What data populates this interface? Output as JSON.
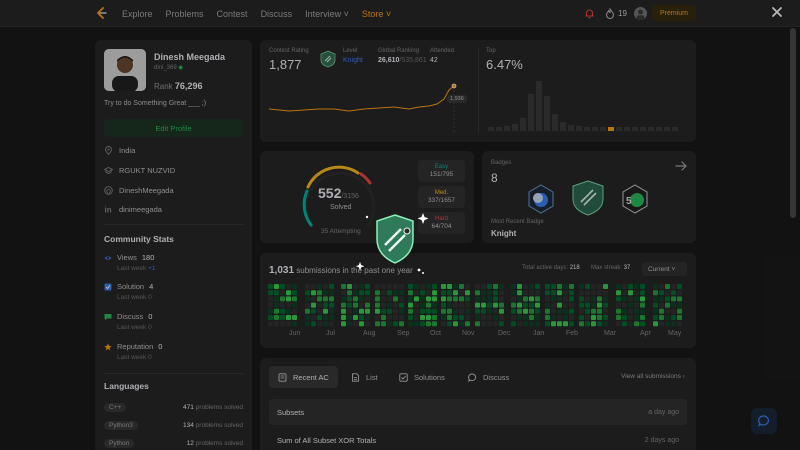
{
  "nav": {
    "items": [
      "Explore",
      "Problems",
      "Contest",
      "Discuss",
      "Interview ˅",
      "Store ˅"
    ],
    "streak": "19",
    "premium": "Premium"
  },
  "profile": {
    "name": "Dinesh Meegada",
    "username": "dini_369",
    "rank_label": "Rank",
    "rank_value": "76,296",
    "bio": "Try to do Something Great ___ ;)",
    "edit": "Edit Profile",
    "location": "India",
    "school": "RGUKT NUZVID",
    "github": "DineshMeegada",
    "linkedin": "dinimeegada"
  },
  "community": {
    "title": "Community Stats",
    "views_label": "Views",
    "views": "180",
    "views_sub": "Last week",
    "views_delta": "+1",
    "solution_label": "Solution",
    "solution": "4",
    "solution_sub": "Last week",
    "solution_delta": "0",
    "discuss_label": "Discuss",
    "discuss": "0",
    "discuss_sub": "Last week",
    "discuss_delta": "0",
    "rep_label": "Reputation",
    "rep": "0",
    "rep_sub": "Last week",
    "rep_delta": "0"
  },
  "languages": {
    "title": "Languages",
    "items": [
      {
        "name": "C++",
        "count": "471",
        "unit": "problems solved"
      },
      {
        "name": "Python3",
        "count": "134",
        "unit": "problems solved"
      },
      {
        "name": "Python",
        "count": "12",
        "unit": "problems solved"
      }
    ]
  },
  "contest": {
    "rating_label": "Contest Rating",
    "rating": "1,877",
    "level_label": "Level",
    "level": "Knight",
    "global_label": "Global Ranking",
    "global": "26,610",
    "global_total": "/535,861",
    "attended_label": "Attended",
    "attended": "42",
    "top_label": "Top",
    "top": "6.47%",
    "tooltip": "1,936"
  },
  "solved": {
    "count": "552",
    "total": "/3156",
    "label": "Solved",
    "attempting": "35 Attempting",
    "easy_label": "Easy",
    "easy": "151/795",
    "med_label": "Med.",
    "med": "337/1657",
    "hard_label": "Hard",
    "hard": "64/704"
  },
  "badges": {
    "label": "Badges",
    "count": "8",
    "recent_label": "Most Recent Badge",
    "recent": "Knight"
  },
  "submissions": {
    "count": "1,031",
    "text": "submissions in the past one year",
    "active_label": "Total active days:",
    "active": "218",
    "streak_label": "Max streak:",
    "streak": "37",
    "current": "Current ˅",
    "months": [
      "Jun",
      "Jul",
      "Aug",
      "Sep",
      "Oct",
      "Nov",
      "Dec",
      "Jan",
      "Feb",
      "Mar",
      "Apr",
      "May"
    ]
  },
  "recent": {
    "tabs": [
      "Recent AC",
      "List",
      "Solutions",
      "Discuss"
    ],
    "view_all": "View all submissions  ›",
    "rows": [
      {
        "title": "Subsets",
        "time": "a day ago"
      },
      {
        "title": "Sum of All Subset XOR Totals",
        "time": "2 days ago"
      }
    ]
  },
  "colors": {
    "accent": "#ffa116",
    "easy": "#00b8a3",
    "medium": "#ffc01e",
    "hard": "#ef4743",
    "green": "#2cbb5d"
  }
}
